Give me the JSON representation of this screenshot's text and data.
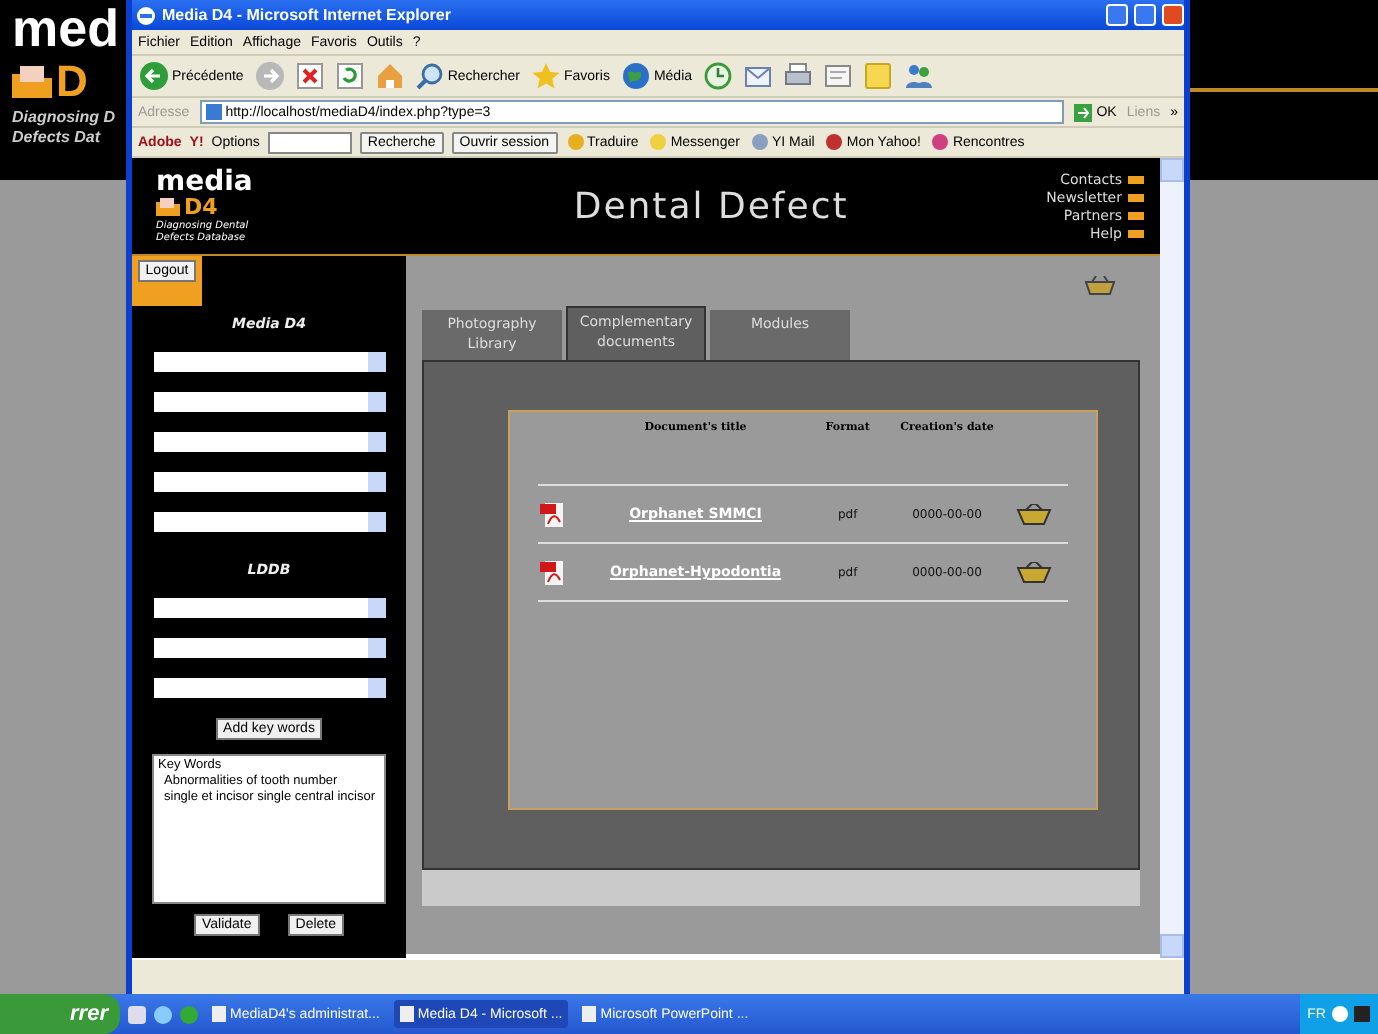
{
  "desktop": {
    "logo_word": "med",
    "logo_letter": "D",
    "tagline_1": "Diagnosing D",
    "tagline_2": "Defects Dat"
  },
  "window": {
    "title": "Media D4 - Microsoft Internet Explorer"
  },
  "menu": [
    "Fichier",
    "Edition",
    "Affichage",
    "Favoris",
    "Outils",
    "?"
  ],
  "toolbar": [
    {
      "kind": "back",
      "label": "Précédente"
    },
    {
      "kind": "forward"
    },
    {
      "kind": "stop"
    },
    {
      "kind": "refresh"
    },
    {
      "kind": "home"
    },
    {
      "kind": "search",
      "label": "Rechercher"
    },
    {
      "kind": "favorites",
      "label": "Favoris"
    },
    {
      "kind": "media",
      "label": "Média"
    },
    {
      "kind": "history"
    },
    {
      "kind": "mail"
    },
    {
      "kind": "print"
    },
    {
      "kind": "edit"
    },
    {
      "kind": "note"
    },
    {
      "kind": "messenger"
    }
  ],
  "address": {
    "label": "Adresse",
    "url": "http://localhost/mediaD4/index.php?type=3",
    "go": "OK",
    "links": "Liens",
    "more": "»"
  },
  "yahoo_bar": {
    "adobe": "Adobe",
    "logo": "Y!",
    "options": "Options",
    "search_button": "Recherche",
    "session_button": "Ouvrir session",
    "links": [
      {
        "kind": "translate",
        "label": "Traduire"
      },
      {
        "kind": "messenger",
        "label": "Messenger"
      },
      {
        "kind": "mail",
        "label": "YI Mail"
      },
      {
        "kind": "myyahoo",
        "label": "Mon Yahoo!"
      },
      {
        "kind": "dating",
        "label": "Rencontres"
      }
    ]
  },
  "site": {
    "logo_word": "media",
    "logo_mark": "D4",
    "logo_tagline": "Diagnosing Dental Defects Database",
    "title": "Dental Defect",
    "links": [
      "Contacts",
      "Newsletter",
      "Partners",
      "Help"
    ]
  },
  "sidebar": {
    "logout": "Logout",
    "filters": [
      {
        "kind": "heading",
        "label": "Media D4"
      },
      {
        "kind": "select"
      },
      {
        "kind": "select"
      },
      {
        "kind": "select"
      },
      {
        "kind": "select"
      },
      {
        "kind": "select"
      },
      {
        "kind": "heading",
        "label": "LDDB"
      },
      {
        "kind": "select"
      },
      {
        "kind": "select"
      },
      {
        "kind": "select"
      }
    ],
    "add_button": "Add key words",
    "keywords": {
      "heading": "Key Words",
      "lines": [
        "Abnormalities of tooth number",
        "single et incisor single central incisor"
      ]
    },
    "buttons": [
      "Validate",
      "Delete"
    ]
  },
  "tabs": [
    {
      "label": "Photography Library",
      "selected": false
    },
    {
      "label": "Complementary documents",
      "selected": true
    },
    {
      "label": "Modules",
      "selected": false
    }
  ],
  "table": {
    "columns": [
      "Document's title",
      "Format",
      "Creation's date"
    ],
    "rows": [
      {
        "title": "Orphanet SMMCI",
        "format": "pdf",
        "date": "0000-00-00"
      },
      {
        "title": "Orphanet-Hypodontia",
        "format": "pdf",
        "date": "0000-00-00"
      }
    ]
  },
  "taskbar": {
    "start": "rrer",
    "tasks": [
      {
        "label": "MediaD4's administrat...",
        "selected": false
      },
      {
        "label": "Media D4 - Microsoft ...",
        "selected": true
      },
      {
        "label": "Microsoft PowerPoint ...",
        "selected": false
      }
    ],
    "language": "FR"
  }
}
